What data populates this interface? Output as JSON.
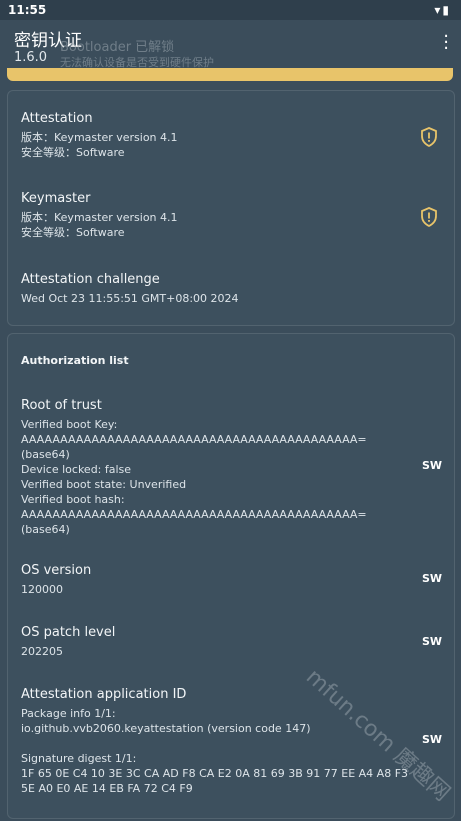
{
  "status": {
    "time": "11:55"
  },
  "app": {
    "title": "密钥认证",
    "version": "1.6.0",
    "banner_line1": "Bootloader 已解锁",
    "banner_line2": "无法确认设备是否受到硬件保护"
  },
  "card1": [
    {
      "heading": "Attestation",
      "line1": "版本：Keymaster version 4.1",
      "line2": "安全等级：Software",
      "icon": "shield-warning-icon"
    },
    {
      "heading": "Keymaster",
      "line1": "版本：Keymaster version 4.1",
      "line2": "安全等级：Software",
      "icon": "shield-warning-icon"
    },
    {
      "heading": "Attestation challenge",
      "line1": "Wed Oct 23 11:55:51 GMT+08:00 2024"
    }
  ],
  "auth": {
    "section_title": "Authorization list",
    "items": [
      {
        "heading": "Root of trust",
        "body": "Verified boot Key:\nAAAAAAAAAAAAAAAAAAAAAAAAAAAAAAAAAAAAAAAAAAA=\n(base64)\nDevice locked: false\nVerified boot state: Unverified\nVerified boot hash:\nAAAAAAAAAAAAAAAAAAAAAAAAAAAAAAAAAAAAAAAAAAA=\n(base64)",
        "tag": "SW"
      },
      {
        "heading": "OS version",
        "body": "120000",
        "tag": "SW"
      },
      {
        "heading": "OS patch level",
        "body": "202205",
        "tag": "SW"
      },
      {
        "heading": "Attestation application ID",
        "body": "Package info 1/1:\nio.github.vvb2060.keyattestation (version code 147)\n\nSignature digest 1/1:\n1F 65 0E C4 10 3E 3C CA AD F8 CA E2 0A 81 69 3B 91 77 EE A4 A8 F3\n5E A0 E0 AE 14 EB FA 72 C4 F9",
        "tag": "SW"
      }
    ]
  },
  "watermark": "mfun.com 魔趣网",
  "colors": {
    "background": "#3b4d5b",
    "warning_strip": "#e8c46a",
    "shield": "#e8c46a"
  }
}
